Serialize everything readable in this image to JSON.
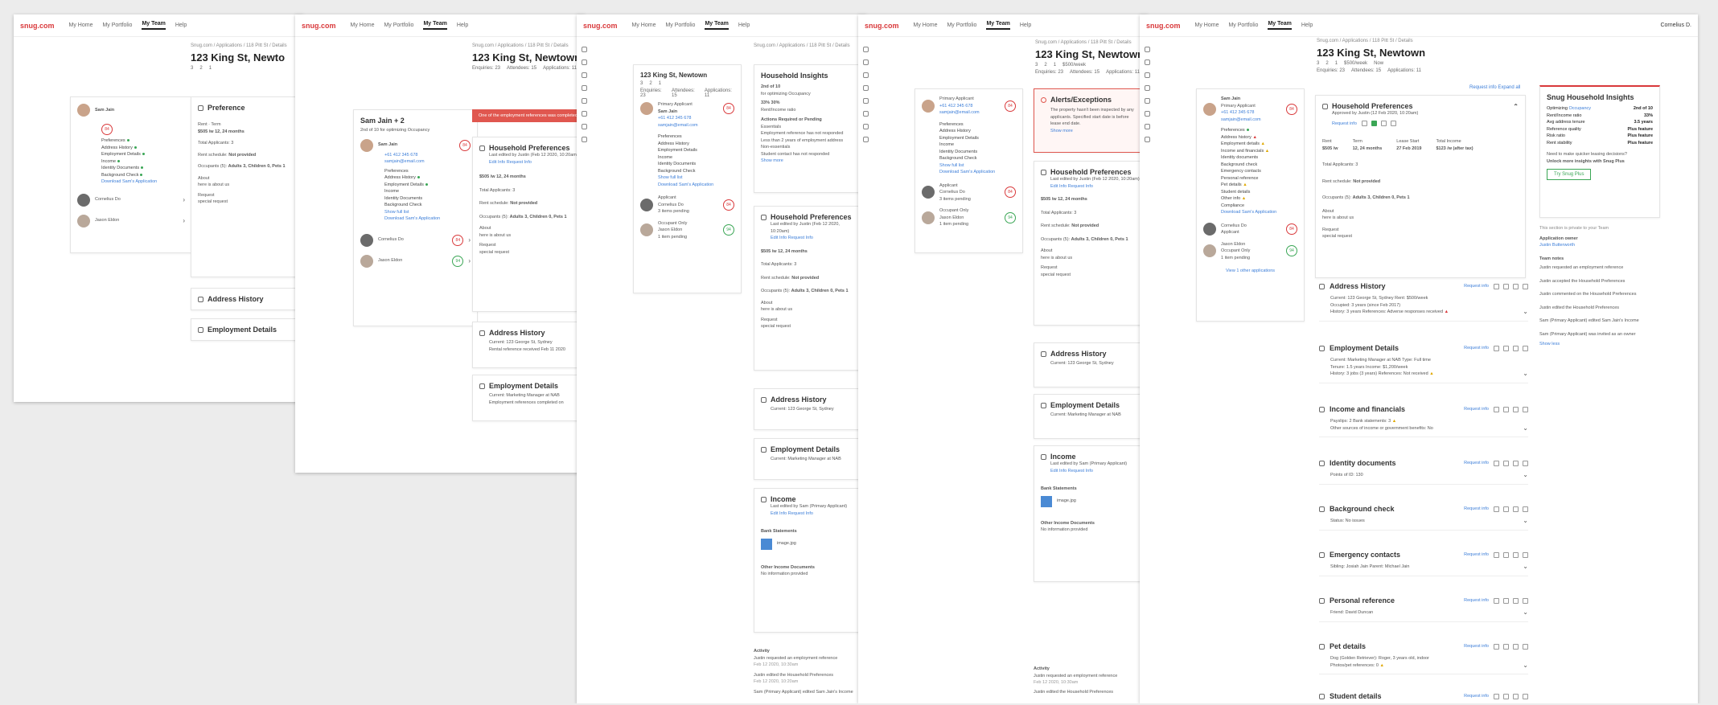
{
  "brand": "snug.com",
  "nav": {
    "home": "My Home",
    "portfolio": "My Portfolio",
    "team": "My Team",
    "help": "Help"
  },
  "user": "Cornelius D.",
  "breadcrumb": "Snug.com / Applications / 118 Pitt St / Details",
  "property": {
    "title": "123 King St, Newtown",
    "title_short": "123 King St, Newto",
    "beds": "3",
    "baths": "2",
    "cars": "1",
    "rent": "$500/week",
    "availability": "Now",
    "enquiries": "Enquiries: 23",
    "attendees": "Attendees: 15",
    "applications": "Applications: 11"
  },
  "applicant": {
    "name": "Sam Jain",
    "role": "Primary Applicant",
    "phone": "+61 412 345 678",
    "email": "samjain@email.com",
    "score": "84",
    "group_name": "Sam Jain + 2",
    "ranking": "2nd of 10 for optimizing Occupancy",
    "download": "Download Sam's Application",
    "show_full": "Show full list",
    "view_other": "View 1 other applications"
  },
  "checklist": [
    "Preferences",
    "Address History",
    "Employment Details",
    "Income",
    "Identity Documents",
    "Background Check"
  ],
  "checklist_full": [
    "Preferences",
    "Address history",
    "Employment details",
    "Income and financials",
    "Identity documents",
    "Background check",
    "Emergency contacts",
    "Personal reference",
    "Pet details",
    "Student details",
    "Other info",
    "Compliance"
  ],
  "others": [
    {
      "name": "Cornelius Do",
      "role": "Applicant",
      "status": "3 items pending",
      "score": "84"
    },
    {
      "name": "Jason Eldon",
      "role": "Occupant Only",
      "status": "1 item pending",
      "score": "94"
    }
  ],
  "banner": "One of the employment references was completed by someone at the same address.",
  "alerts": {
    "title": "Alerts/Exceptions",
    "text": "The property hasn't been inspected by any applicants. Specified start date is before lease end date.",
    "more": "Show more"
  },
  "household": {
    "title": "Household Insights",
    "rank": "2nd of 10",
    "rank_sub": "for optimizing Occupancy",
    "stat1": "33%",
    "stat1_label": "Rent/Income ratio",
    "stat2": "30%",
    "actions_title": "Actions Required or Pending",
    "essentials": "Essentials",
    "a1": "Employment reference has not responded",
    "a2": "Less than 2 years of employment address",
    "nonessentials": "Non-essentials",
    "a3": "Student contact has not responded",
    "show_more": "Show more"
  },
  "preferences": {
    "title": "Household Preferences",
    "title_short": "Preference",
    "edited": "Last edited by Justin (Feb 12 2020, 10:20am)",
    "approved": "Approved by Justin (12 Feb 2020, 10:20am)",
    "edit": "Edit Info",
    "request": "Request Info",
    "rent_label": "Rent",
    "rent": "$505 /w",
    "term_label": "Term",
    "term": "12, 24 months",
    "lease_label": "Lease Start",
    "lease": "27 Feb 2019",
    "income_label": "Total Income",
    "income": "$123 /w (after tax)",
    "total_label": "Total Applicants:",
    "total": "3",
    "schedule_label": "Rent schedule:",
    "schedule": "Not provided",
    "occupants_label": "Occupants (5):",
    "occupants": "Adults 3, Children 0, Pets 1",
    "about_label": "About",
    "about": "here is about us",
    "request_label": "Request",
    "request_text": "special request"
  },
  "address": {
    "title": "Address History",
    "current": "Current: 123 George St, Sydney",
    "rent": "Rent: $500/week",
    "occupied": "Occupied: 3 years (since Feb 2017)",
    "history": "History: 3 years",
    "refs": "References: Adverse responses received",
    "ref_received": "Rental reference received Feb 11 2020"
  },
  "employment": {
    "title": "Employment Details",
    "current": "Current: Marketing Manager at NAB",
    "type": "Type: Full time",
    "tenure": "Tenure: 1.5 years",
    "income": "Income: $1,200/week",
    "history": "History: 3 jobs (3 years)",
    "refs": "References: Not received",
    "ref_line": "Employment references completed on"
  },
  "income": {
    "title": "Income",
    "edited": "Last edited by Sam (Primary Applicant)",
    "bank": "Bank Statements",
    "file": "image.jpg",
    "other": "Other Income Documents",
    "none": "No information provided"
  },
  "financials": {
    "title": "Income and financials",
    "payslips": "Payslips: 2",
    "bank": "Bank statements: 3",
    "other": "Other sources of income or government benefits: No"
  },
  "identity": {
    "title": "Identity documents",
    "points": "Points of ID: 130"
  },
  "background": {
    "title": "Background check",
    "status": "Status: No issues"
  },
  "emergency": {
    "title": "Emergency contacts",
    "text": "Sibling: Josiah Jain   Parent: Michael Jain"
  },
  "personal": {
    "title": "Personal reference",
    "text": "Friend: David Duncan"
  },
  "pets": {
    "title": "Pet details",
    "text": "Dog (Golden Retriever): Roger, 3 years old, indoor",
    "photos": "Photos/pet references: 0"
  },
  "student": {
    "title": "Student details"
  },
  "activity": {
    "title": "Activity",
    "l1": "Justin requested an employment reference",
    "t1": "Feb 12 2020, 10:30am",
    "l2": "Justin edited the Household Preferences",
    "t2": "Feb 12 2020, 10:20am",
    "l3": "Sam (Primary Applicant) edited Sam Jain's Income"
  },
  "insights": {
    "title": "Snug Household Insights",
    "opt_label": "Optimizing",
    "opt_value": "Occupancy",
    "rank": "2nd of 10",
    "rows": [
      [
        "Rent/Income ratio",
        "33%"
      ],
      [
        "Avg address tenure",
        "3.5 years"
      ],
      [
        "Reference quality",
        "Plus feature"
      ],
      [
        "Risk ratio",
        "Plus feature"
      ],
      [
        "Rent stability",
        "Plus feature"
      ]
    ],
    "cta1": "Need to make quicker leasing decisions?",
    "cta2": "Unlock more insights with Snug Plus",
    "button": "Try Snug Plus",
    "private": "This section is private to your Team",
    "owner_label": "Application owner",
    "owner": "Justin Butterworth",
    "notes_title": "Team notes",
    "notes": [
      "Justin requested an employment reference",
      "Justin accepted the Household Preferences",
      "Justin commented on the Household Preferences",
      "Justin edited the Household Preferences",
      "Sam (Primary Applicant) edited Sam Jain's Income",
      "Sam (Primary Applicant) was invited as an owner"
    ],
    "show_less": "Show less"
  },
  "request_info": "Request info",
  "expand_all": "Expand all"
}
